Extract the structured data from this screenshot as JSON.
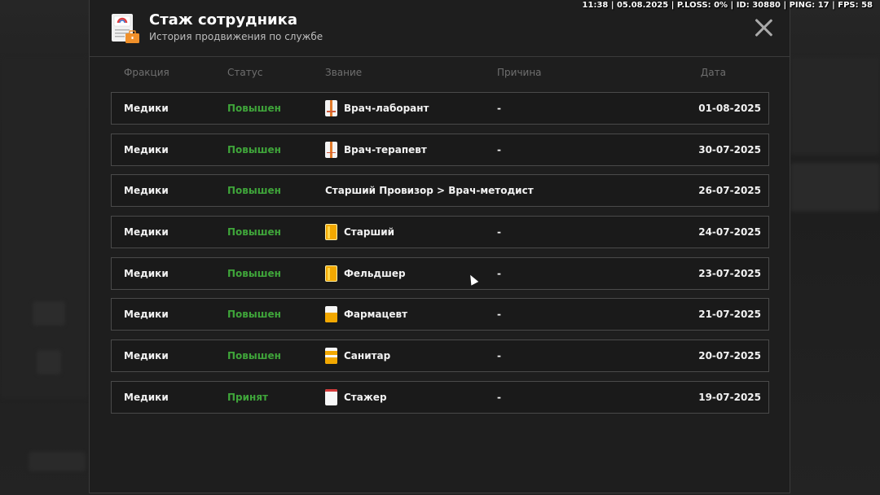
{
  "hud": {
    "text": "11:38 | 05.08.2025 | P.LOSS: 0% | ID: 30880 | PING: 17 | FPS: 58"
  },
  "modal": {
    "title": "Стаж сотрудника",
    "subtitle": "История продвижения по службе",
    "header_icon": "document-briefcase-icon",
    "close_icon": "close-icon"
  },
  "columns": {
    "faction": "Фракция",
    "status": "Статус",
    "rank": "Звание",
    "reason": "Причина",
    "date": "Дата"
  },
  "rows": [
    {
      "faction": "Медики",
      "status": "Повышен",
      "rank": "Врач-лаборант",
      "rank_icon": "coat-icon",
      "reason": "-",
      "date": "01-08-2025"
    },
    {
      "faction": "Медики",
      "status": "Повышен",
      "rank": "Врач-терапевт",
      "rank_icon": "coat-icon",
      "reason": "-",
      "date": "30-07-2025"
    },
    {
      "faction": "Медики",
      "status": "Повышен",
      "rank": "Старший Провизор > Врач-методист",
      "rank_icon": "",
      "reason": "",
      "date": "26-07-2025"
    },
    {
      "faction": "Медики",
      "status": "Повышен",
      "rank": "Старший",
      "rank_icon": "gold-badge-icon",
      "reason": "-",
      "date": "24-07-2025"
    },
    {
      "faction": "Медики",
      "status": "Повышен",
      "rank": "Фельдшер",
      "rank_icon": "gold-badge-icon",
      "reason": "-",
      "date": "23-07-2025"
    },
    {
      "faction": "Медики",
      "status": "Повышен",
      "rank": "Фармацевт",
      "rank_icon": "half-gold-badge-icon",
      "reason": "-",
      "date": "21-07-2025"
    },
    {
      "faction": "Медики",
      "status": "Повышен",
      "rank": "Санитар",
      "rank_icon": "striped-badge-icon",
      "reason": "-",
      "date": "20-07-2025"
    },
    {
      "faction": "Медики",
      "status": "Принят",
      "rank": "Стажер",
      "rank_icon": "white-badge-icon",
      "reason": "-",
      "date": "19-07-2025"
    }
  ],
  "colors": {
    "status_green": "#3fa53a",
    "modal_bg": "#1e1e1e",
    "row_border": "#4a4a4a"
  }
}
